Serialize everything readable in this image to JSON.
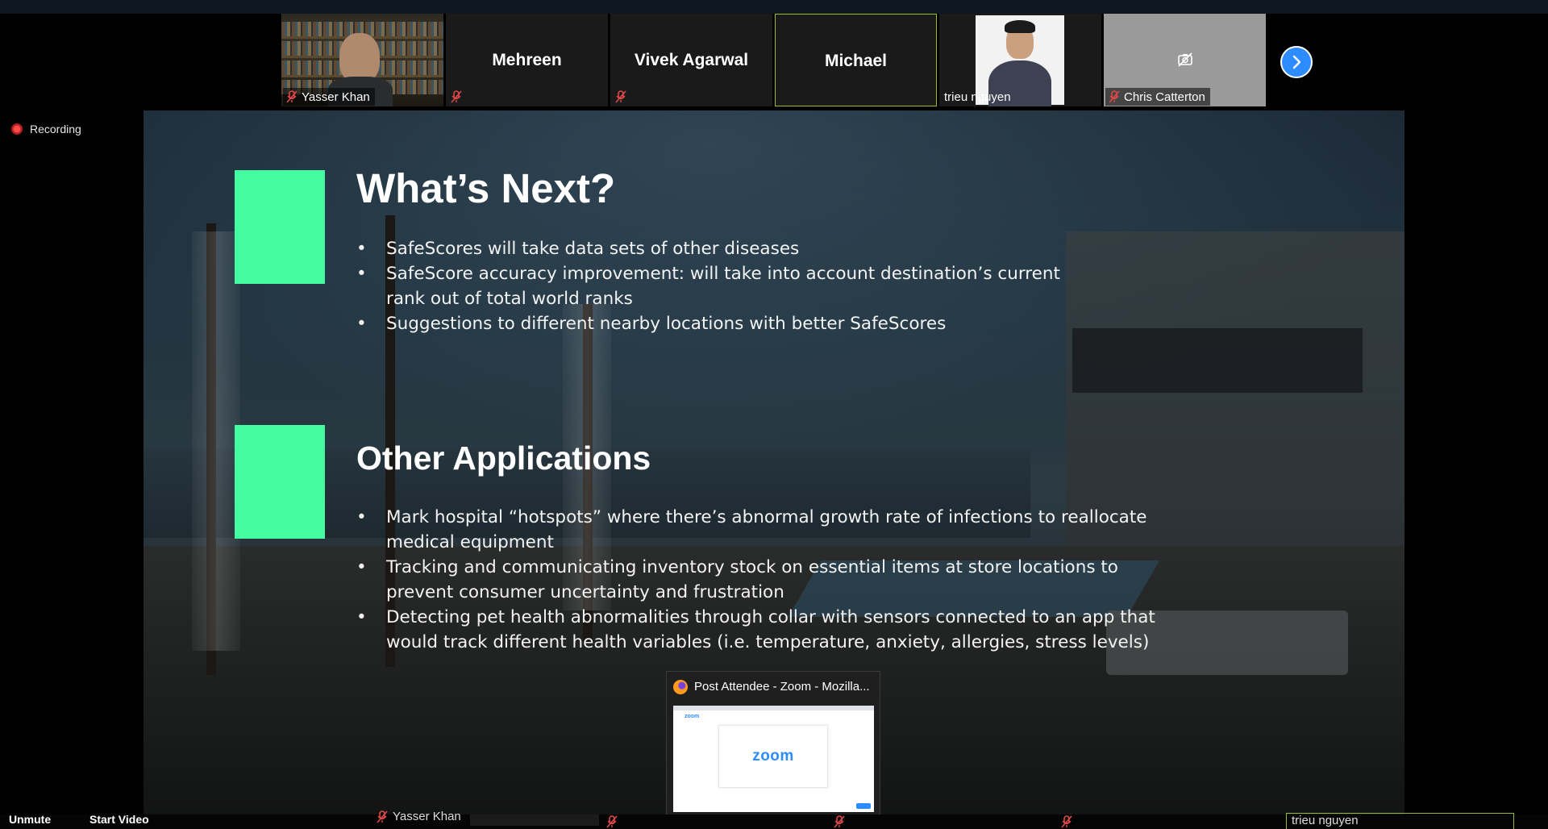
{
  "participants": [
    {
      "name": "Yasser Khan",
      "mic_muted": true,
      "video": true
    },
    {
      "name": "Mehreen",
      "mic_muted": true,
      "video": false
    },
    {
      "name": "Vivek Agarwal",
      "mic_muted": true,
      "video": false
    },
    {
      "name": "Michael",
      "mic_muted": false,
      "video": false,
      "active_speaker": true
    },
    {
      "name": "trieu nguyen",
      "mic_muted": false,
      "video": true
    },
    {
      "name": "Chris Catterton",
      "mic_muted": true,
      "video": false,
      "camera_off_icon": "camera-off-icon"
    }
  ],
  "recording": {
    "label": "Recording"
  },
  "slide": {
    "sections": [
      {
        "title": "What’s Next?",
        "bullets": [
          "SafeScores will take data sets of other diseases",
          "SafeScore accuracy improvement: will take into account destination’s current rank out of total world ranks",
          "Suggestions to different nearby locations with better SafeScores"
        ]
      },
      {
        "title": "Other Applications",
        "bullets": [
          "Mark hospital “hotspots” where there’s abnormal growth rate of infections to reallocate medical equipment",
          "Tracking and communicating inventory stock on essential items at store locations to prevent consumer uncertainty and frustration",
          "Detecting pet health abnormalities through collar with sensors connected to an app that would track different health variables (i.e. temperature, anxiety, allergies, stress levels)"
        ]
      }
    ],
    "accent_color": "#43fba0"
  },
  "taskbar_preview": {
    "title": "Post Attendee - Zoom - Mozilla...",
    "thumb_logo": "zoom"
  },
  "controls": {
    "unmute": "Unmute",
    "start_video": "Start Video"
  },
  "bottom_names": {
    "left": "Yasser Khan",
    "right": "trieu nguyen"
  },
  "colors": {
    "zoom_blue": "#2d8cff",
    "active_border": "#9bbb2e",
    "recording_red": "#ff4a4a"
  }
}
